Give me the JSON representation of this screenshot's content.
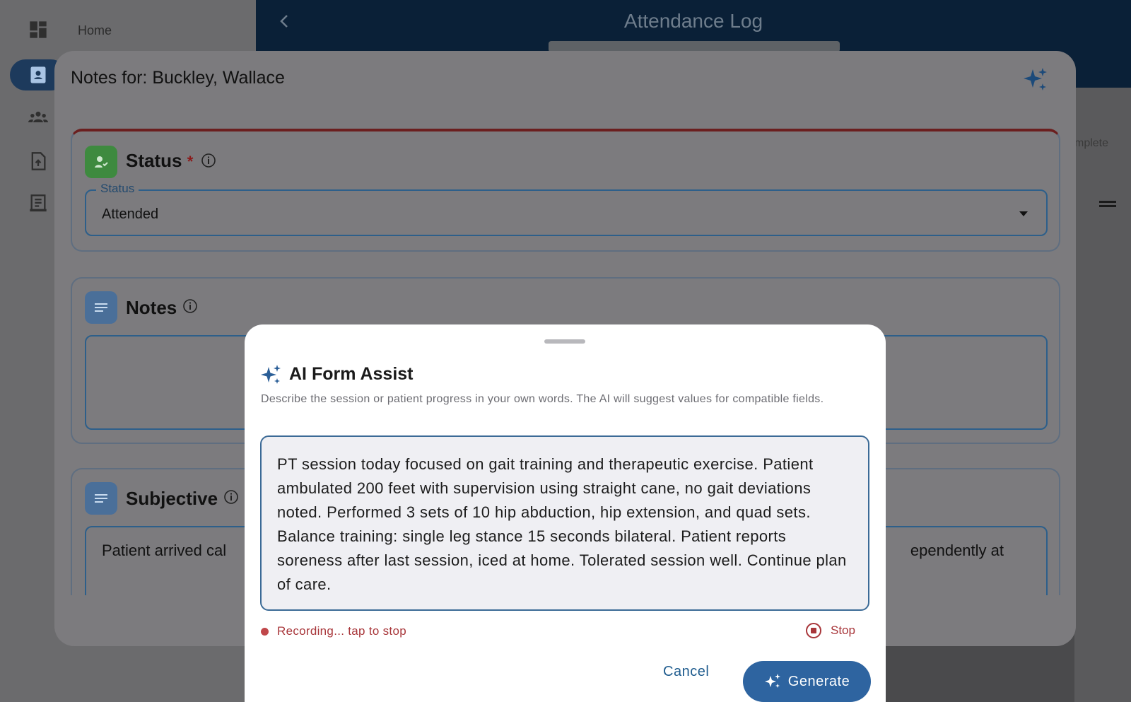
{
  "background": {
    "sidebar": {
      "home_label": "Home"
    },
    "header": {
      "title": "Attendance Log"
    },
    "right_panel": {
      "status_text": "mplete"
    }
  },
  "notes_sheet": {
    "title": "Notes for: Buckley, Wallace",
    "status_card": {
      "title": "Status",
      "required_mark": "*",
      "field_label": "Status",
      "field_value": "Attended"
    },
    "notes_card": {
      "title": "Notes"
    },
    "subjective_card": {
      "title": "Subjective",
      "text_left": "Patient arrived cal",
      "text_right": "ependently at"
    }
  },
  "ai_modal": {
    "title": "AI Form Assist",
    "description": "Describe the session or patient progress in your own words. The AI will suggest values for compatible fields.",
    "prompt_text": "PT session today focused on gait training and therapeutic exercise. Patient ambulated 200 feet with supervision using straight cane, no gait deviations noted. Performed 3 sets of 10 hip abduction, hip extension, and quad sets. Balance training: single leg stance 15 seconds bilateral. Patient reports soreness after last session, iced at home. Tolerated session well. Continue plan of care.",
    "recording_status": "Recording... tap to stop",
    "stop_label": "Stop",
    "cancel_label": "Cancel",
    "generate_label": "Generate"
  },
  "colors": {
    "accent": "#2e64a0",
    "recording": "#a8363a",
    "header": "#0a2037",
    "status_badge": "#3e8a3f",
    "notes_badge": "#4a6f99"
  },
  "icons": [
    "dashboard-icon",
    "contact-card-icon",
    "group-icon",
    "file-upload-icon",
    "report-icon",
    "back-chevron-icon",
    "sparkle-icon",
    "person-check-icon",
    "lines-icon",
    "info-icon",
    "stop-icon",
    "menu-icon"
  ]
}
